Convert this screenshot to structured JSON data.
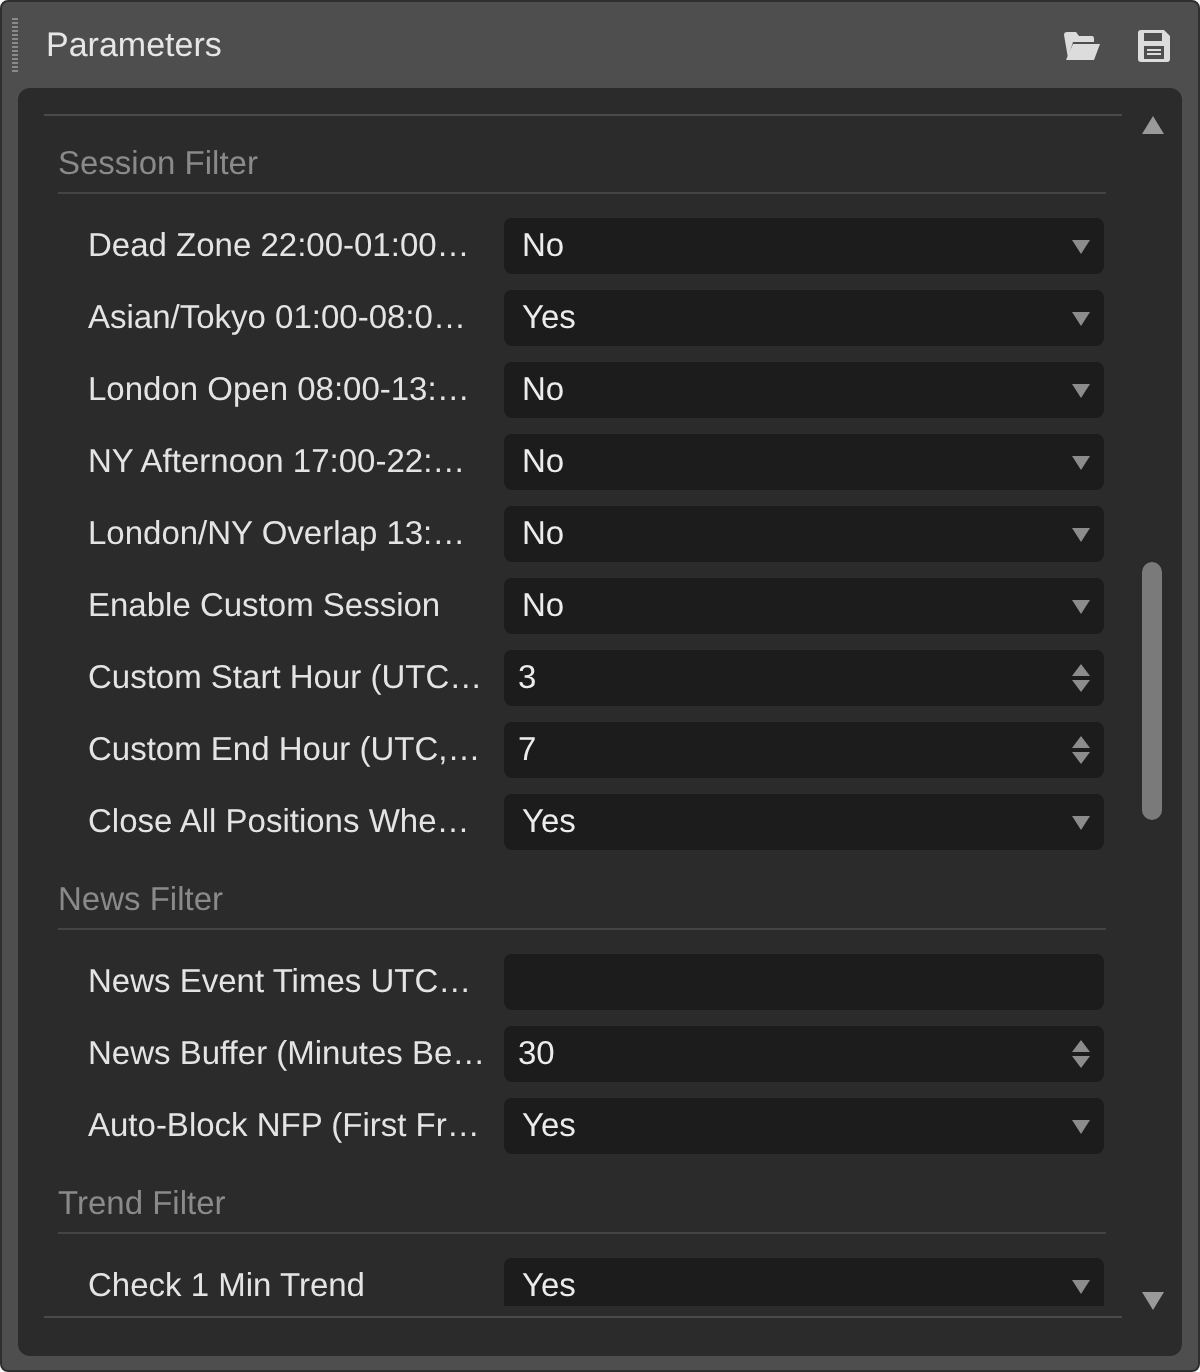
{
  "panel": {
    "title": "Parameters"
  },
  "sections": [
    {
      "heading": "Session Filter",
      "rows": [
        {
          "label": "Dead Zone 22:00-01:00…",
          "kind": "select",
          "value": "No"
        },
        {
          "label": "Asian/Tokyo 01:00-08:0…",
          "kind": "select",
          "value": "Yes"
        },
        {
          "label": "London Open 08:00-13:…",
          "kind": "select",
          "value": "No"
        },
        {
          "label": "NY Afternoon 17:00-22:…",
          "kind": "select",
          "value": "No"
        },
        {
          "label": "London/NY Overlap 13:…",
          "kind": "select",
          "value": "No"
        },
        {
          "label": "Enable Custom Session",
          "kind": "select",
          "value": "No"
        },
        {
          "label": "Custom Start Hour (UTC…",
          "kind": "number",
          "value": "3"
        },
        {
          "label": "Custom End Hour (UTC,…",
          "kind": "number",
          "value": "7"
        },
        {
          "label": "Close All Positions Whe…",
          "kind": "select",
          "value": "Yes"
        }
      ]
    },
    {
      "heading": "News Filter",
      "rows": [
        {
          "label": "News Event Times UTC…",
          "kind": "text"
        },
        {
          "label": "News Buffer (Minutes Be…",
          "kind": "number",
          "value": "30"
        },
        {
          "label": "Auto-Block NFP (First Fr…",
          "kind": "select",
          "value": "Yes"
        }
      ]
    },
    {
      "heading": "Trend Filter",
      "rows": [
        {
          "label": "Check 1 Min Trend",
          "kind": "select",
          "value": "Yes"
        }
      ]
    }
  ]
}
